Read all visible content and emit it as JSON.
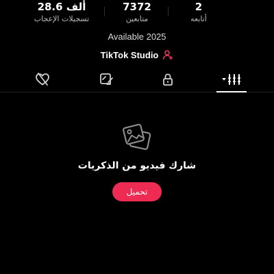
{
  "stats": [
    {
      "value": "28.6 ألف",
      "label": "تسجيلات الإعجاب"
    },
    {
      "value": "7372",
      "label": "متابعين"
    },
    {
      "value": "2",
      "label": "أتابعه"
    }
  ],
  "bio": "Available 2025",
  "studio": {
    "label": "TikTok Studio",
    "icon": "user-add-icon"
  },
  "tabs": [
    {
      "icon": "heart-hidden-icon",
      "active": false
    },
    {
      "icon": "reposts-icon",
      "active": false
    },
    {
      "icon": "lock-icon",
      "active": false
    },
    {
      "icon": "videos-grid-icon",
      "active": true
    }
  ],
  "empty_state": {
    "icon": "photos-icon",
    "message": "شارك فيديو من الذكريات",
    "button_label": "تحميل"
  },
  "colors": {
    "background": "#000000",
    "accent": "#ee2b52",
    "studio_icon": "#e8375a",
    "muted_text": "#b9b9b9"
  }
}
